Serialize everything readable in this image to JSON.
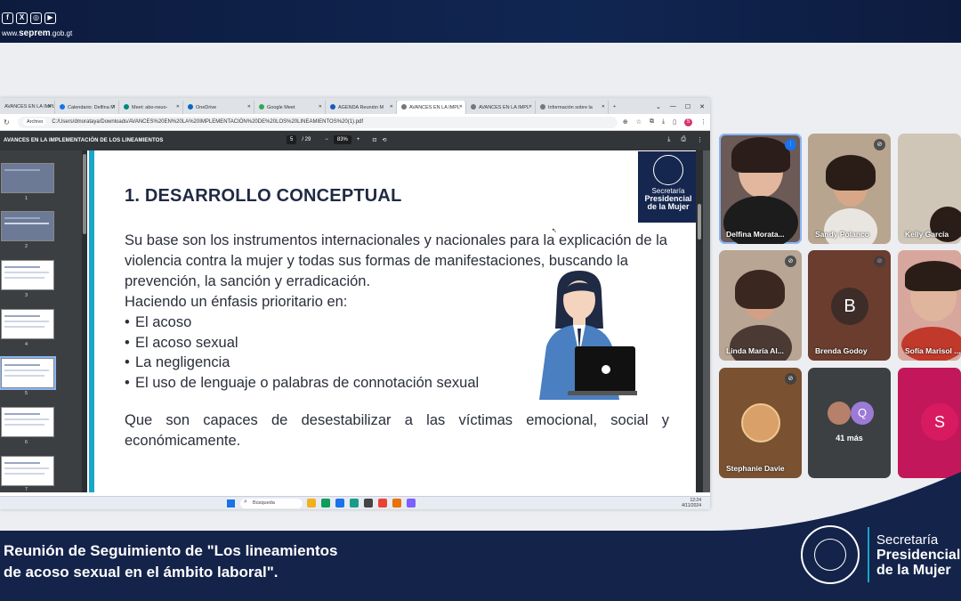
{
  "social": {
    "icons": [
      "facebook-icon",
      "x-icon",
      "instagram-icon",
      "youtube-icon"
    ],
    "site_prefix": "www.",
    "site_main": "seprem",
    "site_suffix": ".gob.gt"
  },
  "browser": {
    "tabs": [
      {
        "label": "AVANCES EN LA IMPL"
      },
      {
        "label": "Calendario: Delfina M"
      },
      {
        "label": "Meet: abo-neuo-"
      },
      {
        "label": "OneDrive"
      },
      {
        "label": "Google Meet"
      },
      {
        "label": "AGENDA Reunión M"
      },
      {
        "label": "AVANCES EN LA IMPL"
      },
      {
        "label": "AVANCES EN LA IMPL"
      },
      {
        "label": "Información sobre la"
      }
    ],
    "new_tab": "+",
    "address_chip": "Archivo",
    "url": "C:/Users/dmorataya/Downloads/AVANCES%20EN%20LA%20IMPLEMENTACIÓN%20DE%20LOS%20LINEAMIENTOS%20(1).pdf",
    "profile_initial": "S"
  },
  "pdf": {
    "title": "AVANCES EN LA IMPLEMENTACIÓN DE LOS LINEAMIENTOS",
    "page": "5",
    "total": "/ 29",
    "zoom": "83%",
    "thumb_numbers": [
      "1",
      "2",
      "3",
      "4",
      "5",
      "6",
      "7"
    ]
  },
  "slide": {
    "heading": "1. DESARROLLO CONCEPTUAL",
    "para1": "Su base son los instrumentos internacionales y nacionales para la explicación de la violencia contra la mujer y todas sus formas de manifestaciones, buscando la prevención, la sanción y erradicación.",
    "lead": "Haciendo un énfasis prioritario en:",
    "bullets": [
      "El acoso",
      "El acoso sexual",
      "La negligencia",
      "El uso de lenguaje o palabras de connotación sexual"
    ],
    "para2": "Que son capaces de desestabilizar a las víctimas emocional, social y económicamente.",
    "logo_line1": "Secretaría",
    "logo_line2": "Presidencial",
    "logo_line3": "de la Mujer"
  },
  "taskbar": {
    "search": "Búsqueda",
    "time": "12:24",
    "date": "4/11/2024"
  },
  "participants": [
    {
      "name": "Delfina Morata...",
      "muted": false
    },
    {
      "name": "Sandy Polanco",
      "muted": true
    },
    {
      "name": "Kelly García",
      "muted": false
    },
    {
      "name": "Linda María Al...",
      "muted": true
    },
    {
      "name": "Brenda Godoy",
      "muted": true,
      "initial": "B"
    },
    {
      "name": "Sofía Marisol ...",
      "muted": false
    },
    {
      "name": "Stephanie Davie",
      "muted": true
    },
    {
      "name": "41 más",
      "initial": "Q"
    },
    {
      "name": "S",
      "initial": "S"
    }
  ],
  "footer": {
    "caption_line1": "Reunión de Seguimiento de \"Los lineamientos",
    "caption_line2": "de acoso sexual en el ámbito laboral\".",
    "sec_line1": "Secretaría",
    "sec_line2": "Presidencial",
    "sec_line3": "de la Mujer"
  },
  "colors": {
    "navy": "#14234a",
    "accent": "#1aa6c9",
    "speaker_outline": "#8ab4f8"
  }
}
